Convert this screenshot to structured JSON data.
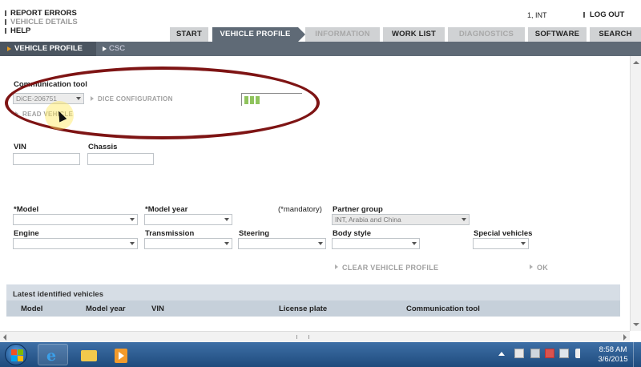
{
  "top_links": [
    "REPORT ERRORS",
    "VEHICLE DETAILS",
    "HELP"
  ],
  "user": "1, INT",
  "logout": "LOG OUT",
  "tabs": [
    {
      "label": "START",
      "state": "normal"
    },
    {
      "label": "VEHICLE PROFILE",
      "state": "active"
    },
    {
      "label": "INFORMATION",
      "state": "disabled"
    },
    {
      "label": "WORK LIST",
      "state": "normal"
    },
    {
      "label": "DIAGNOSTICS",
      "state": "disabled"
    },
    {
      "label": "SOFTWARE",
      "state": "normal"
    },
    {
      "label": "SEARCH",
      "state": "normal"
    }
  ],
  "subtabs": [
    "VEHICLE PROFILE",
    "CSC"
  ],
  "comm": {
    "title": "Communication tool",
    "selected": "DiCE-206751",
    "dice_config": "DICE CONFIGURATION",
    "read_vehicle": "READ VEHICLE",
    "signal_bars": 3
  },
  "ids": {
    "vin": "VIN",
    "chassis": "Chassis"
  },
  "form": {
    "model": "*Model",
    "model_year": "*Model year",
    "mandatory": "(*mandatory)",
    "partner_group": "Partner group",
    "partner_group_value": "INT, Arabia and China",
    "engine": "Engine",
    "transmission": "Transmission",
    "steering": "Steering",
    "body_style": "Body style",
    "special_vehicles": "Special vehicles",
    "clear": "CLEAR VEHICLE PROFILE",
    "ok": "OK"
  },
  "latest": {
    "title": "Latest identified vehicles",
    "columns": [
      "Model",
      "Model year",
      "VIN",
      "License plate",
      "Communication tool"
    ]
  },
  "taskbar": {
    "time": "8:58 AM",
    "date": "3/6/2015"
  },
  "colors": {
    "active_tab": "#5f6a76",
    "annotation": "#7e1414",
    "signal": "#8fc35d",
    "accent_arrow": "#e39a23"
  }
}
